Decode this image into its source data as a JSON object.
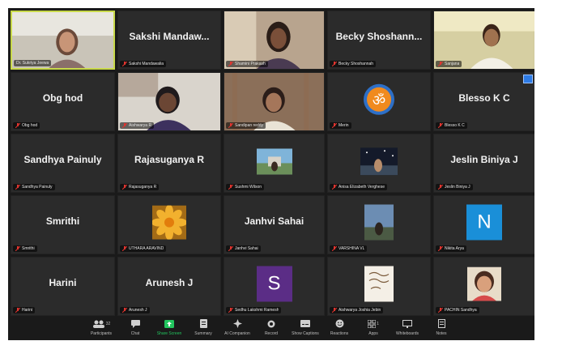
{
  "colors": {
    "background": "#1a1a1a",
    "tile": "#2b2b2b",
    "active_border": "#c8d94a",
    "muted_mic": "#e0342f",
    "share_screen": "#22c55e",
    "avatar_n": "#1a8fd8",
    "avatar_s": "#5b2d86"
  },
  "tiles": [
    {
      "name": "",
      "label": "Dr. Sukriya Jeewa",
      "photo": "woman-video"
    },
    {
      "name": "Sakshi Mandaw...",
      "label": "Sakshi Mandawalia",
      "photo": ""
    },
    {
      "name": "",
      "label": "Shamini Prakash",
      "photo": "woman-video"
    },
    {
      "name": "Becky Shoshann...",
      "label": "Becky Shoshannah",
      "photo": ""
    },
    {
      "name": "",
      "label": "Sanjana",
      "photo": "man-video"
    },
    {
      "name": "Obg hod",
      "label": "Obg hod",
      "photo": ""
    },
    {
      "name": "",
      "label": "Aishwarya R",
      "photo": "woman-video"
    },
    {
      "name": "",
      "label": "Sandipan reddy",
      "photo": "woman-video"
    },
    {
      "name": "",
      "label": "Merin",
      "photo": "om-logo"
    },
    {
      "name": "Blesso K C",
      "label": "Blesso K C",
      "photo": ""
    },
    {
      "name": "Sandhya Painuly",
      "label": "Sandhya Painuly",
      "photo": ""
    },
    {
      "name": "Rajasuganya R",
      "label": "Rajasuganya R",
      "photo": ""
    },
    {
      "name": "",
      "label": "Sushmi Wilson",
      "photo": "landscape-thumb"
    },
    {
      "name": "",
      "label": "Anisa Elizabeth Verghese",
      "photo": "night-thumb"
    },
    {
      "name": "Jeslin Biniya J",
      "label": "Jeslin Biniya J",
      "photo": ""
    },
    {
      "name": "Smrithi",
      "label": "Smrithi",
      "photo": ""
    },
    {
      "name": "",
      "label": "UTHARA ARAVIND",
      "photo": "flower-thumb"
    },
    {
      "name": "Janhvi Sahai",
      "label": "Janhvi Sahai",
      "photo": ""
    },
    {
      "name": "",
      "label": "VARSHINA VL",
      "photo": "sky-thumb"
    },
    {
      "name": "",
      "label": "Nikita Arya",
      "photo": "letter-n",
      "letter": "N"
    },
    {
      "name": "Harini",
      "label": "Harini",
      "photo": ""
    },
    {
      "name": "Arunesh J",
      "label": "Arunesh J",
      "photo": ""
    },
    {
      "name": "",
      "label": "Sedhu Lakshmi Ramesh",
      "photo": "letter-s",
      "letter": "S"
    },
    {
      "name": "",
      "label": "Aishwarya Joshia Jebin",
      "photo": "note-thumb"
    },
    {
      "name": "",
      "label": "PACHIN Sandhya",
      "photo": "child-thumb"
    }
  ],
  "toolbar": [
    {
      "label": "Participants",
      "icon": "participants-icon",
      "badge": "32"
    },
    {
      "label": "Chat",
      "icon": "chat-icon"
    },
    {
      "label": "Share Screen",
      "icon": "share-screen-icon"
    },
    {
      "label": "Summary",
      "icon": "summary-icon"
    },
    {
      "label": "AI Companion",
      "icon": "ai-companion-icon"
    },
    {
      "label": "Record",
      "icon": "record-icon"
    },
    {
      "label": "Show Captions",
      "icon": "captions-icon"
    },
    {
      "label": "Reactions",
      "icon": "reactions-icon"
    },
    {
      "label": "Apps",
      "icon": "apps-icon",
      "badge": "1"
    },
    {
      "label": "Whiteboards",
      "icon": "whiteboards-icon"
    },
    {
      "label": "Notes",
      "icon": "notes-icon"
    }
  ]
}
